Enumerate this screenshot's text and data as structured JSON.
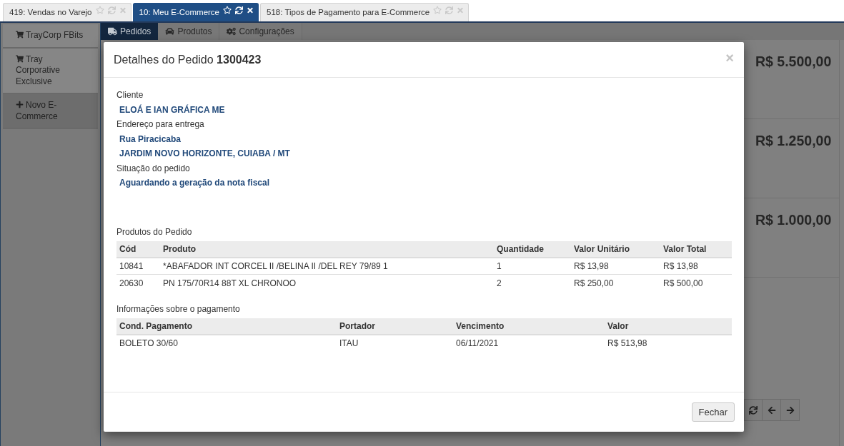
{
  "tabs": [
    {
      "label": "419: Vendas no Varejo",
      "selected": false
    },
    {
      "label": "10: Meu E-Commerce",
      "selected": true
    },
    {
      "label": "518: Tipos de Pagamento para E-Commerce",
      "selected": false
    }
  ],
  "sidebar": {
    "items": [
      {
        "label": "TrayCorp FBits",
        "kind": "store"
      },
      {
        "label": "Tray Corporative Exclusive",
        "kind": "store"
      },
      {
        "label": "Novo E-Commerce",
        "kind": "add"
      }
    ]
  },
  "main": {
    "subtabs": [
      {
        "label": "Pedidos",
        "selected": true
      },
      {
        "label": "Produtos",
        "selected": false
      },
      {
        "label": "Configurações",
        "selected": false
      }
    ],
    "summary_values": [
      "R$ 5.500,00",
      "R$ 1.250,00",
      "R$ 1.000,00"
    ]
  },
  "modal": {
    "title": "Detalhes do Pedido **1300423**",
    "close": "×",
    "fields": [
      {
        "label": "Cliente",
        "values": [
          "ELOÁ E IAN GRÁFICA ME"
        ]
      },
      {
        "label": "Endereço para entrega",
        "values": [
          "Rua Piracicaba",
          "JARDIM NOVO HORIZONTE, CUIABA / MT"
        ]
      },
      {
        "label": "Situação do pedido",
        "values": [
          "Aguardando a geração da nota fiscal"
        ]
      }
    ],
    "products": {
      "title": "Produtos do Pedido",
      "columns": [
        "Cód",
        "Produto",
        "Quantidade",
        "Valor Unitário",
        "Valor Total"
      ],
      "rows": [
        [
          "10841",
          "*ABAFADOR INT CORCEL II /BELINA II /DEL REY 79/89 1",
          "1",
          "R$ 13,98",
          "R$ 13,98"
        ],
        [
          "20630",
          "PN 175/70R14 88T XL CHRONOO",
          "2",
          "R$ 250,00",
          "R$ 500,00"
        ]
      ]
    },
    "payment": {
      "title": "Informações sobre o pagamento",
      "columns": [
        "Cond. Pagamento",
        "Portador",
        "Vencimento",
        "Valor"
      ],
      "rows": [
        [
          "BOLETO 30/60",
          "ITAU",
          "06/11/2021",
          "R$ 513,98"
        ]
      ]
    },
    "buttons": [
      "Fechar"
    ]
  }
}
